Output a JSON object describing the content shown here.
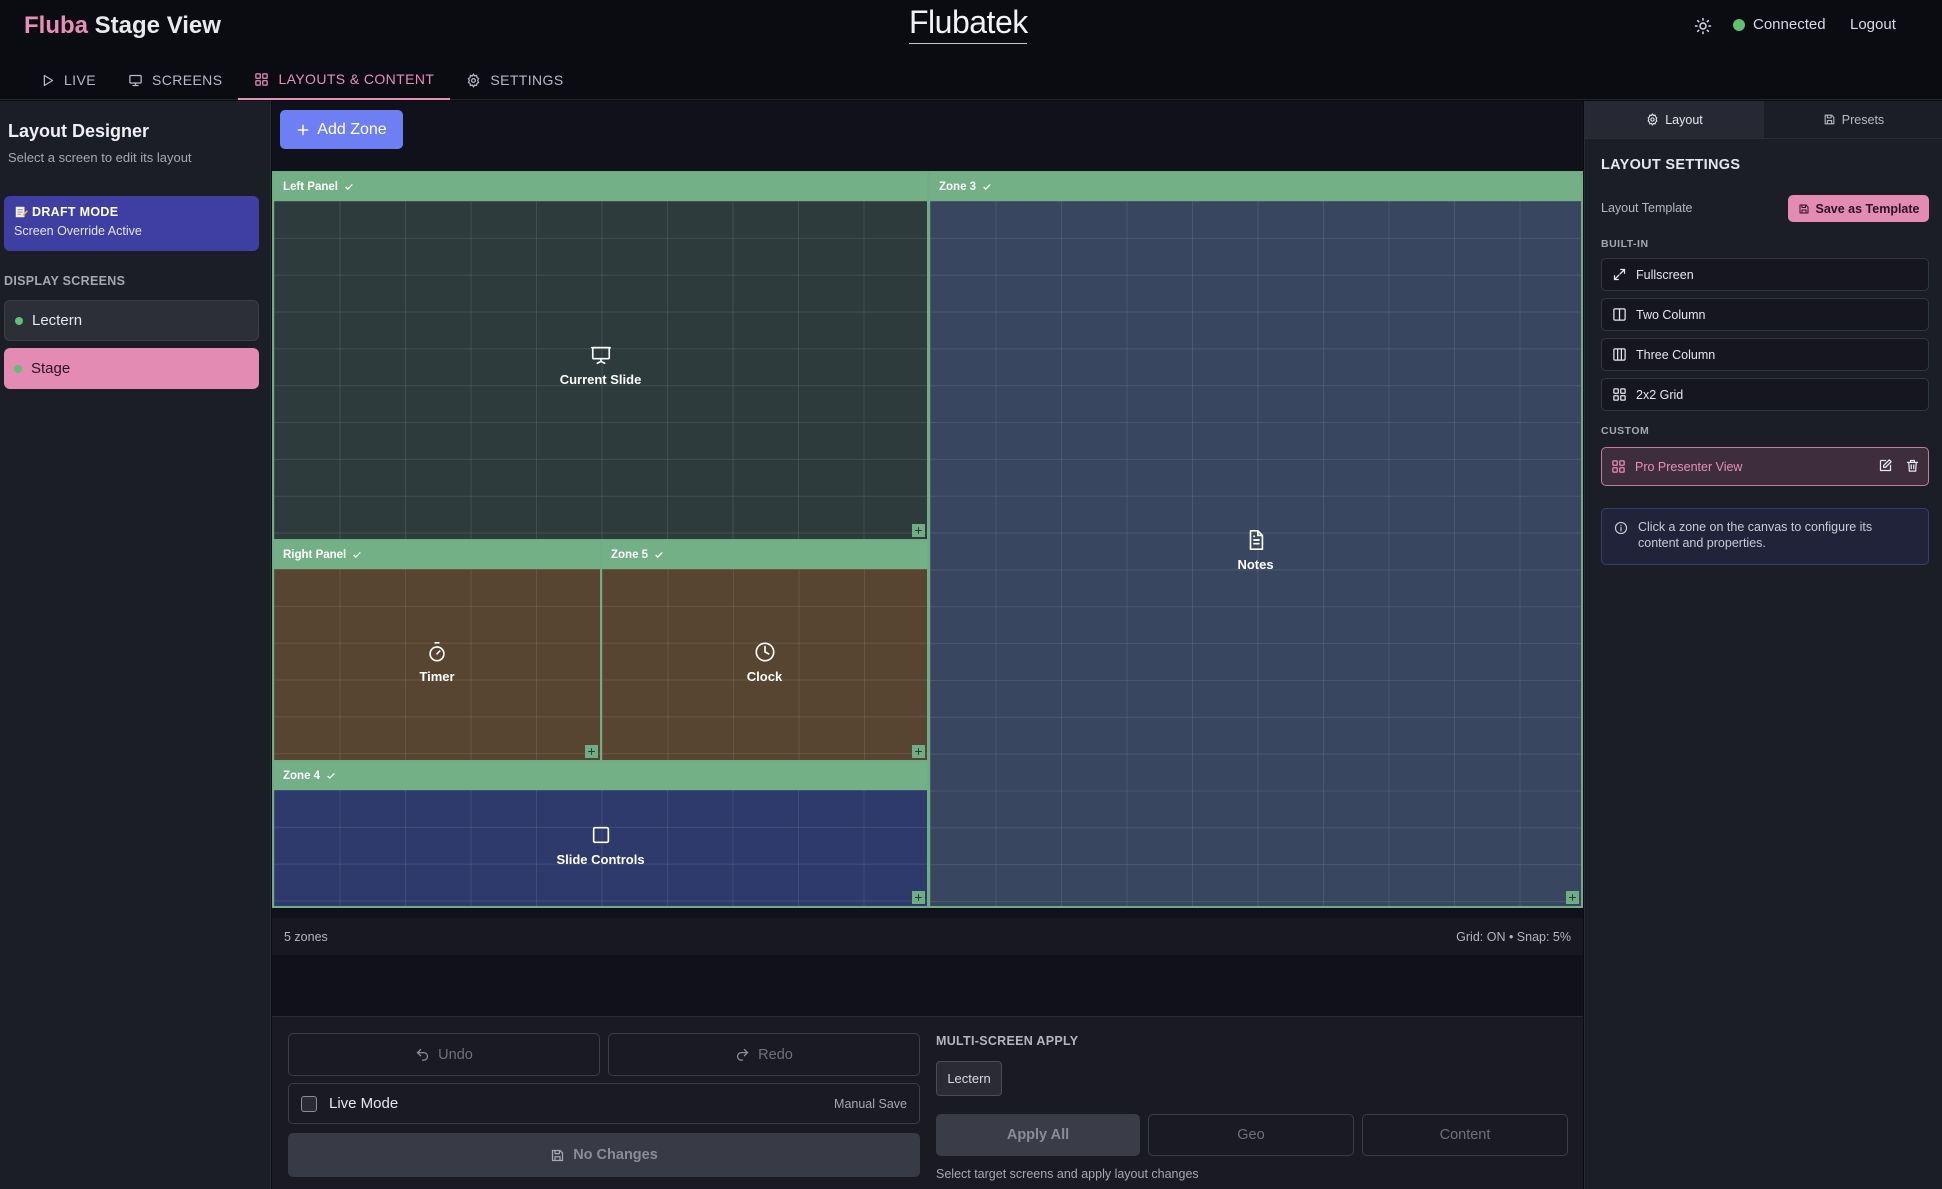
{
  "header": {
    "brand": "Fluba",
    "title_rest": " Stage View",
    "logo_text": "Flubatek",
    "status": "Connected",
    "logout": "Logout"
  },
  "tabs": [
    {
      "label": "LIVE",
      "icon": "play-icon"
    },
    {
      "label": "SCREENS",
      "icon": "monitor-icon"
    },
    {
      "label": "LAYOUTS & CONTENT",
      "icon": "layout-grid-icon",
      "active": true
    },
    {
      "label": "SETTINGS",
      "icon": "gear-icon"
    }
  ],
  "sidebar": {
    "title": "Layout Designer",
    "subtitle": "Select a screen to edit its layout",
    "draft_title": "DRAFT MODE",
    "draft_subtitle": "Screen Override Active",
    "section_label": "DISPLAY SCREENS",
    "screens": [
      {
        "label": "Lectern",
        "status_color": "#5fbf72"
      },
      {
        "label": "Stage",
        "status_color": "#5fbf72",
        "selected": true
      }
    ]
  },
  "canvas": {
    "add_zone_label": "Add Zone",
    "zones": [
      {
        "title": "Left Panel",
        "content": "Current Slide",
        "icon": "presentation-icon",
        "color": "#2e3b3c"
      },
      {
        "title": "Zone 3",
        "content": "Notes",
        "icon": "document-icon",
        "color": "#384660"
      },
      {
        "title": "Right Panel",
        "content": "Timer",
        "icon": "stopwatch-icon",
        "color": "#574531"
      },
      {
        "title": "Zone 5",
        "content": "Clock",
        "icon": "clock-icon",
        "color": "#574531"
      },
      {
        "title": "Zone 4",
        "content": "Slide Controls",
        "icon": "square-icon",
        "color": "#2e3a6b"
      }
    ],
    "zone_count": "5 zones",
    "grid_info": "Grid: ON • Snap: 5%"
  },
  "bottom": {
    "undo": "Undo",
    "redo": "Redo",
    "live_mode": "Live Mode",
    "live_mode_checked": false,
    "manual_save": "Manual Save",
    "no_changes": "No Changes",
    "multi_title": "MULTI-SCREEN APPLY",
    "target_chip": "Lectern",
    "apply_all": "Apply All",
    "geo": "Geo",
    "content": "Content",
    "hint": "Select target screens and apply layout changes"
  },
  "right_panel": {
    "tabs": [
      {
        "label": "Layout",
        "icon": "gear-icon",
        "active": true
      },
      {
        "label": "Presets",
        "icon": "save-icon"
      }
    ],
    "title": "LAYOUT SETTINGS",
    "template_label": "Layout Template",
    "save_template": "Save as Template",
    "builtin_label": "BUILT-IN",
    "builtin": [
      {
        "label": "Fullscreen",
        "icon": "expand-icon"
      },
      {
        "label": "Two Column",
        "icon": "two-column-icon"
      },
      {
        "label": "Three Column",
        "icon": "three-column-icon"
      },
      {
        "label": "2x2 Grid",
        "icon": "grid-icon"
      }
    ],
    "custom_label": "CUSTOM",
    "custom": [
      {
        "label": "Pro Presenter View",
        "icon": "grid-icon"
      }
    ],
    "info": "Click a zone on the canvas to configure its content and properties."
  },
  "colors": {
    "accent_pink": "#e88fb6",
    "accent_indigo": "#6e7ff3",
    "zone_header_green": "#74b086",
    "status_green": "#5fbf72"
  }
}
